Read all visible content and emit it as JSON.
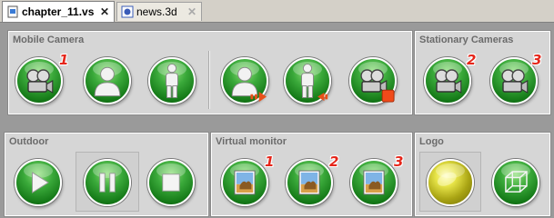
{
  "tabs": [
    {
      "label": "chapter_11.vs",
      "active": true,
      "icon": "document-icon"
    },
    {
      "label": "news.3d",
      "active": false,
      "icon": "scene-3d-icon"
    }
  ],
  "close_glyph": "✕",
  "panels": {
    "mobile_camera": {
      "title": "Mobile Camera",
      "buttons": [
        {
          "name": "mobile-camera-1-button",
          "icon": "film-camera-icon",
          "badge": "1"
        },
        {
          "name": "presenter-bust-button",
          "icon": "person-bust-icon",
          "badge": ""
        },
        {
          "name": "presenter-full-button",
          "icon": "person-full-icon",
          "badge": ""
        },
        {
          "name": "bust-arrow-out-button",
          "icon": "person-bust-arrow-out-icon",
          "badge": ""
        },
        {
          "name": "full-arrow-in-button",
          "icon": "person-full-arrow-in-icon",
          "badge": ""
        },
        {
          "name": "camera-stop-button",
          "icon": "film-camera-stop-icon",
          "badge": ""
        }
      ]
    },
    "stationary_cameras": {
      "title": "Stationary Cameras",
      "buttons": [
        {
          "name": "stationary-camera-2-button",
          "icon": "film-camera-icon",
          "badge": "2"
        },
        {
          "name": "stationary-camera-3-button",
          "icon": "film-camera-icon",
          "badge": "3"
        }
      ]
    },
    "outdoor": {
      "title": "Outdoor",
      "buttons": [
        {
          "name": "play-button",
          "icon": "play-icon"
        },
        {
          "name": "pause-button",
          "icon": "pause-icon"
        },
        {
          "name": "stop-button",
          "icon": "stop-icon"
        }
      ]
    },
    "virtual_monitor": {
      "title": "Virtual monitor",
      "buttons": [
        {
          "name": "monitor-image-1-button",
          "icon": "picture-icon",
          "badge": "1"
        },
        {
          "name": "monitor-image-2-button",
          "icon": "picture-icon",
          "badge": "2"
        },
        {
          "name": "monitor-image-3-button",
          "icon": "picture-icon",
          "badge": "3"
        }
      ]
    },
    "logo": {
      "title": "Logo",
      "buttons": [
        {
          "name": "logo-show-button",
          "icon": "yellow-sphere-icon"
        },
        {
          "name": "logo-cube-button",
          "icon": "wire-cube-icon"
        }
      ]
    }
  },
  "colors": {
    "button_green": "#2e9e2e",
    "badge_red": "#e5261a",
    "panel_bg": "#d6d6d6",
    "title_grey": "#6b6b6b",
    "logo_yellow": "#d9d43a"
  }
}
